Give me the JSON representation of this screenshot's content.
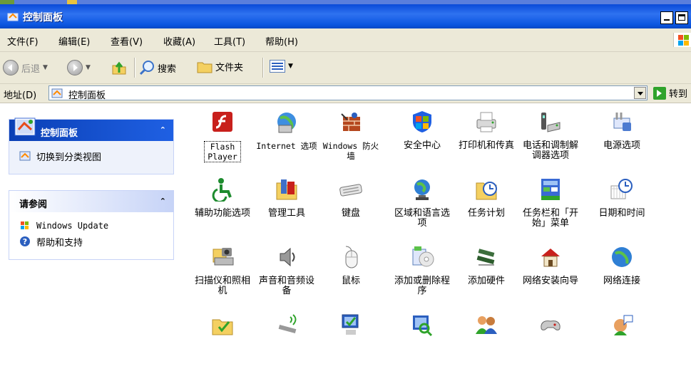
{
  "window": {
    "title": "控制面板",
    "min_label": "",
    "max_label": ""
  },
  "menubar": {
    "items": [
      "文件(F)",
      "编辑(E)",
      "查看(V)",
      "收藏(A)",
      "工具(T)",
      "帮助(H)"
    ]
  },
  "toolbar": {
    "back_label": "后退",
    "search_label": "搜索",
    "folders_label": "文件夹"
  },
  "address": {
    "label": "地址(D)",
    "value": "控制面板",
    "go_label": "转到"
  },
  "leftpane": {
    "panel1": {
      "title": "控制面板",
      "chevron": "⌃",
      "items": [
        {
          "label": "切换到分类视图",
          "icon": "switch-view-icon"
        }
      ]
    },
    "panel2": {
      "title": "请参阅",
      "chevron": "⌃",
      "items": [
        {
          "label": "Windows Update",
          "icon": "windows-update-icon"
        },
        {
          "label": "帮助和支持",
          "icon": "help-icon"
        }
      ]
    }
  },
  "applets": [
    {
      "label": "Flash\nPlayer",
      "icon": "flash-player-icon"
    },
    {
      "label": "Internet 选项",
      "icon": "internet-options-icon"
    },
    {
      "label": "Windows 防火墙",
      "icon": "firewall-icon"
    },
    {
      "label": "安全中心",
      "icon": "security-center-icon"
    },
    {
      "label": "打印机和传真",
      "icon": "printers-icon"
    },
    {
      "label": "电话和调制解调器选项",
      "icon": "phone-modem-icon"
    },
    {
      "label": "电源选项",
      "icon": "power-options-icon"
    },
    {
      "label": "辅助功能选项",
      "icon": "accessibility-icon"
    },
    {
      "label": "管理工具",
      "icon": "admin-tools-icon"
    },
    {
      "label": "键盘",
      "icon": "keyboard-icon"
    },
    {
      "label": "区域和语言选项",
      "icon": "region-language-icon"
    },
    {
      "label": "任务计划",
      "icon": "scheduled-tasks-icon"
    },
    {
      "label": "任务栏和「开始」菜单",
      "icon": "taskbar-startmenu-icon"
    },
    {
      "label": "日期和时间",
      "icon": "date-time-icon"
    },
    {
      "label": "扫描仪和照相机",
      "icon": "scanner-camera-icon"
    },
    {
      "label": "声音和音频设备",
      "icon": "sound-icon"
    },
    {
      "label": "鼠标",
      "icon": "mouse-icon"
    },
    {
      "label": "添加或删除程序",
      "icon": "add-remove-programs-icon"
    },
    {
      "label": "添加硬件",
      "icon": "add-hardware-icon"
    },
    {
      "label": "网络安装向导",
      "icon": "network-setup-icon"
    },
    {
      "label": "网络连接",
      "icon": "network-connections-icon"
    },
    {
      "label": "",
      "icon": "folder-options-icon"
    },
    {
      "label": "",
      "icon": "wireless-icon"
    },
    {
      "label": "",
      "icon": "system-icon"
    },
    {
      "label": "",
      "icon": "search-icon"
    },
    {
      "label": "",
      "icon": "user-accounts-icon"
    },
    {
      "label": "",
      "icon": "game-controllers-icon"
    },
    {
      "label": "",
      "icon": "speech-icon"
    }
  ]
}
